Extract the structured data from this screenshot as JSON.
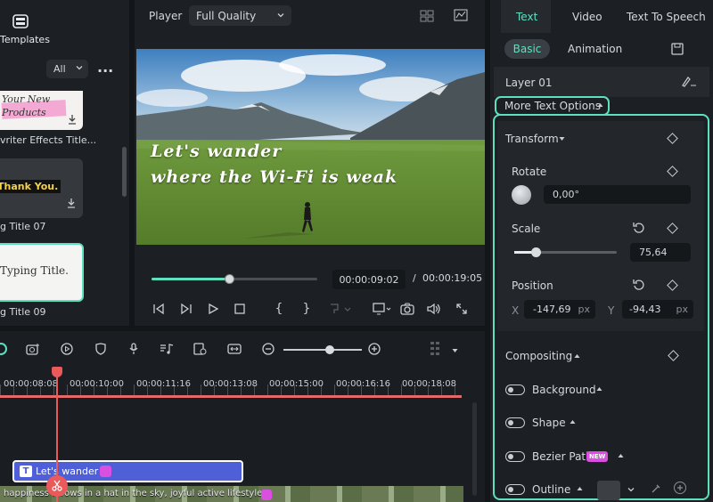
{
  "library": {
    "templates_label": "Templates",
    "filter_value": "All",
    "more_label": "...",
    "cards": [
      {
        "thumb_text": "Your New Products",
        "label": "vriter Effects Title..."
      },
      {
        "thumb_text": "Thank You.",
        "label": "g Title 07"
      },
      {
        "thumb_text": "Typing Title.",
        "label": "g Title 09"
      }
    ]
  },
  "player": {
    "label": "Player",
    "quality": "Full Quality",
    "overlay_line1": "Let's wander",
    "overlay_line2": "where the Wi-Fi is weak",
    "current_time": "00:00:09:02",
    "separator": "/",
    "total_time": "00:00:19:05",
    "progress": 0.47
  },
  "panel": {
    "tabs": [
      "Text",
      "Video",
      "Text To Speech"
    ],
    "active_tab": "Text",
    "subtabs": [
      "Basic",
      "Animation"
    ],
    "layer": "Layer 01",
    "more_options": "More Text Options",
    "transform": {
      "title": "Transform",
      "rotate_label": "Rotate",
      "rotate_value": "0,00°",
      "scale_label": "Scale",
      "scale_value": "75,64",
      "position_label": "Position",
      "x_label": "X",
      "x_value": "-147,69",
      "x_unit": "px",
      "y_label": "Y",
      "y_value": "-94,43",
      "y_unit": "px"
    },
    "compositing": {
      "title": "Compositing",
      "items": [
        "Background",
        "Shape",
        "Bezier Path",
        "Outline"
      ],
      "new_badge": "NEW"
    },
    "colors": {
      "accent": "#5ee0c0",
      "badge": "#d94fe0"
    }
  },
  "timeline": {
    "timecodes": [
      "00:00:08:08",
      "00:00:10:00",
      "00:00:11:16",
      "00:00:13:08",
      "00:00:15:00",
      "00:00:16:16",
      "00:00:18:08"
    ],
    "clip_label": "Let's wander",
    "caption": "happiness throws in a hat in the sky, joyful active lifestyle"
  }
}
